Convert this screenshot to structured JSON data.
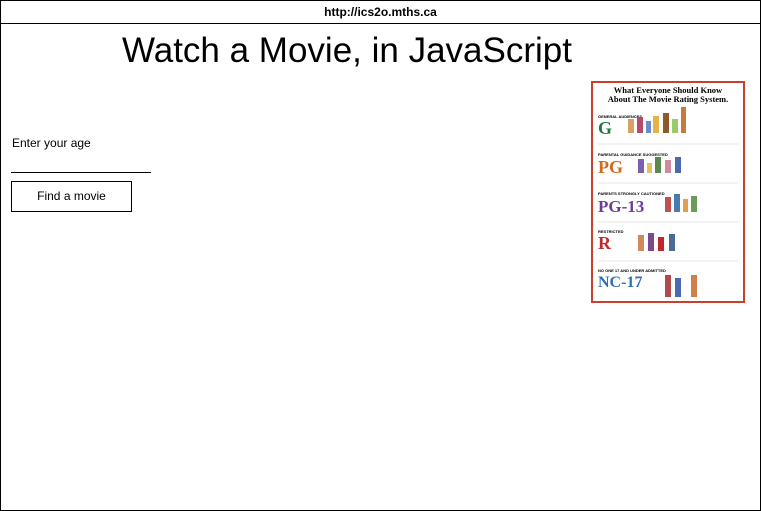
{
  "browser": {
    "url": "http://ics2o.mths.ca"
  },
  "page": {
    "title": "Watch a Movie, in JavaScript"
  },
  "form": {
    "age_label": "Enter your age",
    "age_value": "",
    "age_placeholder": "",
    "find_button_label": "Find a movie"
  },
  "poster": {
    "heading_line1": "What Everyone Should Know",
    "heading_line2": "About The Movie Rating System.",
    "ratings": [
      {
        "caption": "GENERAL AUDIENCES",
        "code": "G",
        "color": "#1f7a3a"
      },
      {
        "caption": "PARENTAL GUIDANCE SUGGESTED",
        "code": "PG",
        "color": "#d2691e"
      },
      {
        "caption": "PARENTS STRONGLY CAUTIONED",
        "code": "PG-13",
        "color": "#6a3d9a"
      },
      {
        "caption": "RESTRICTED",
        "code": "R",
        "color": "#c0282a"
      },
      {
        "caption": "NO ONE 17 AND UNDER ADMITTED",
        "code": "NC-17",
        "color": "#2f6fb5"
      }
    ]
  }
}
